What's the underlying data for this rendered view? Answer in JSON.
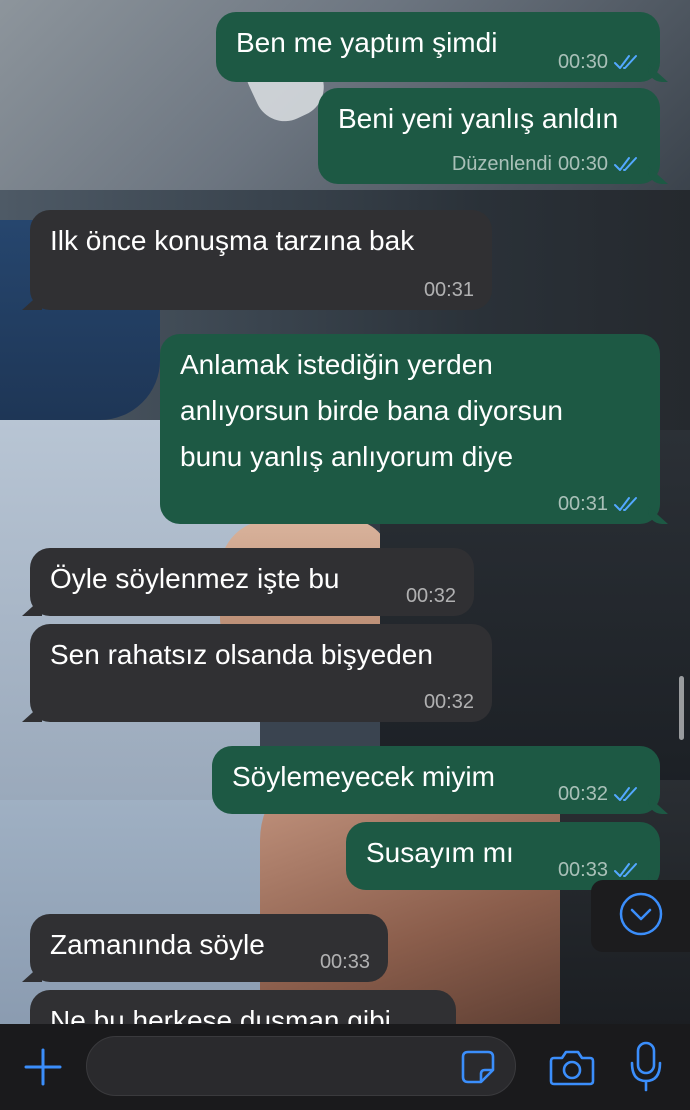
{
  "theme": {
    "outgoing_bubble": "#1d5944",
    "incoming_bubble": "#303033",
    "read_tick_color": "#53a8ff",
    "accent": "#3b8efb"
  },
  "messages": [
    {
      "direction": "outgoing",
      "text": "Ben me yaptım şimdi",
      "time": "00:30",
      "status": "read",
      "edited": ""
    },
    {
      "direction": "outgoing",
      "text": "Beni yeni yanlış anldın",
      "time": "00:30",
      "status": "read",
      "edited": "Düzenlendi"
    },
    {
      "direction": "incoming",
      "text": "Ilk önce konuşma tarzına bak",
      "time": "00:31",
      "status": "",
      "edited": ""
    },
    {
      "direction": "outgoing",
      "text": "Anlamak istediğin yerden\nanlıyorsun birde bana diyorsun\nbunu yanlış anlıyorum diye",
      "time": "00:31",
      "status": "read",
      "edited": ""
    },
    {
      "direction": "incoming",
      "text": "Öyle söylenmez işte bu",
      "time": "00:32",
      "status": "",
      "edited": ""
    },
    {
      "direction": "incoming",
      "text": "Sen rahatsız olsanda bişyeden",
      "time": "00:32",
      "status": "",
      "edited": ""
    },
    {
      "direction": "outgoing",
      "text": "Söylemeyecek miyim",
      "time": "00:32",
      "status": "read",
      "edited": ""
    },
    {
      "direction": "outgoing",
      "text": "Susayım mı",
      "time": "00:33",
      "status": "read",
      "edited": ""
    },
    {
      "direction": "incoming",
      "text": "Zamanında söyle",
      "time": "00:33",
      "status": "",
      "edited": ""
    },
    {
      "direction": "incoming",
      "text": "Ne bu herkese duşman gibi",
      "time": "",
      "status": "",
      "edited": ""
    }
  ],
  "composer": {
    "attach_icon": "plus-icon",
    "sticker_icon": "sticker-icon",
    "camera_icon": "camera-icon",
    "mic_icon": "microphone-icon",
    "input_value": ""
  },
  "scroll_button_icon": "chevron-down-circle-icon"
}
